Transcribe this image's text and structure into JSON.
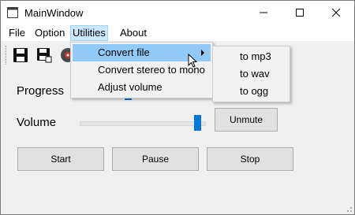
{
  "window": {
    "title": "MainWindow"
  },
  "menubar": {
    "items": [
      {
        "label": "File"
      },
      {
        "label": "Option"
      },
      {
        "label": "Utilities"
      },
      {
        "label": "About"
      }
    ]
  },
  "controls": {
    "progress_label": "Progress",
    "volume_label": "Volume",
    "volume_level_percent": 100,
    "mute_button": "Unmute",
    "start_button": "Start",
    "pause_button": "Pause",
    "stop_button": "Stop"
  },
  "utilities_menu": {
    "items": [
      {
        "label": "Convert file",
        "highlighted": true,
        "has_submenu": true
      },
      {
        "label": "Convert stereo to mono"
      },
      {
        "label": "Adjust volume"
      }
    ]
  },
  "convert_submenu": {
    "items": [
      {
        "label": "to mp3"
      },
      {
        "label": "to wav"
      },
      {
        "label": "to ogg"
      }
    ]
  },
  "colors": {
    "accent": "#0078d7",
    "highlight": "#91c9f7"
  }
}
